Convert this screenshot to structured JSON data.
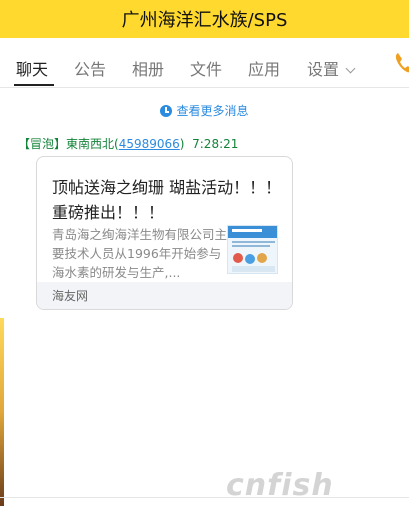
{
  "window": {
    "title": "广州海洋汇水族/SPS"
  },
  "tabs": [
    {
      "label": "聊天",
      "active": true
    },
    {
      "label": "公告"
    },
    {
      "label": "相册"
    },
    {
      "label": "文件"
    },
    {
      "label": "应用"
    },
    {
      "label": "设置"
    }
  ],
  "chat": {
    "more_messages": "查看更多消息",
    "message": {
      "badge": "【冒泡】",
      "sender_name": "東南西北",
      "sender_id_open": "(",
      "sender_id": "45989066",
      "sender_id_close": ")",
      "time": "7:28:21",
      "card": {
        "title": "顶帖送海之绚珊 瑚盐活动！！！ 重磅推出！！！",
        "description": "青岛海之绚海洋生物有限公司主要技术人员从1996年开始参与海水素的研发与生产,...",
        "source": "海友网"
      }
    }
  },
  "watermark": "cnfish",
  "colors": {
    "titlebar": "#ffd92e",
    "link": "#2b8be0",
    "sender": "#13833a"
  }
}
